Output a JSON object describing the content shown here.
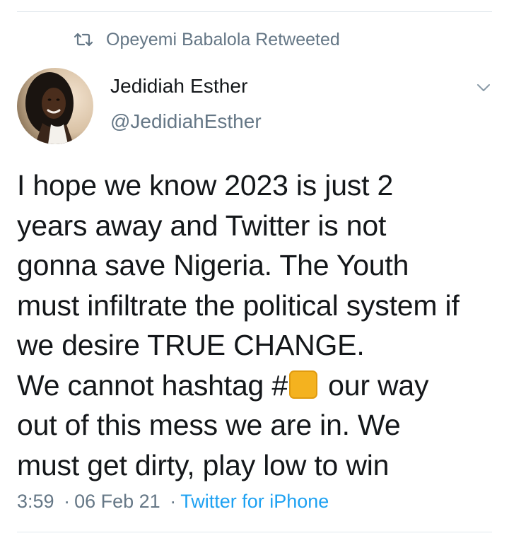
{
  "retweet": {
    "icon": "retweet-icon",
    "text": "Opeyemi Babalola Retweeted"
  },
  "author": {
    "display_name": "Jedidiah Esther",
    "handle": "@JedidiahEsther"
  },
  "tweet": {
    "lines": [
      "I hope we know 2023 is just 2",
      "years away and Twitter is not",
      "gonna save Nigeria. The Youth",
      "must infiltrate the political system if",
      "we desire TRUE CHANGE."
    ],
    "line6_before": "We cannot hashtag #",
    "line6_after": " our way",
    "lines_after": [
      "out of this mess we are in. We",
      "must get dirty, play low to win"
    ],
    "emoji": "orange-square-emoji"
  },
  "meta": {
    "time": "3:59",
    "date": "06 Feb 21",
    "separator": "·",
    "source": "Twitter for iPhone"
  },
  "colors": {
    "text": "#14171a",
    "secondary": "#657786",
    "link": "#1da1f2",
    "divider": "#e1e8ed",
    "emoji": "#f4b21f"
  }
}
